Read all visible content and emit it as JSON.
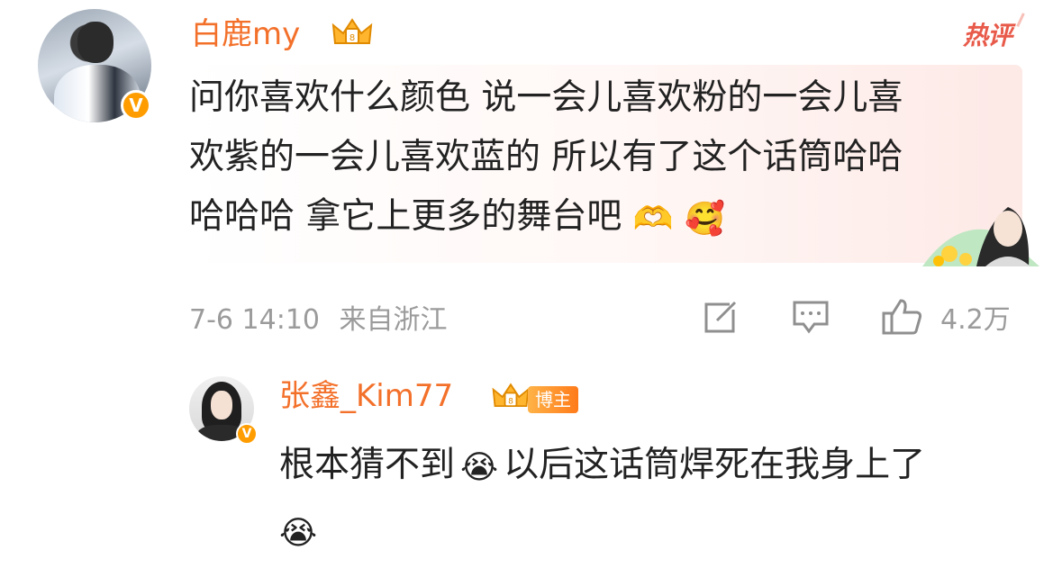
{
  "main_comment": {
    "username": "白鹿my",
    "hot_tag": "热评",
    "text_lines": [
      "问你喜欢什么颜色 说一会儿喜欢粉的一会儿喜",
      "欢紫的一会儿喜欢蓝的 所以有了这个话筒哈哈",
      "哈哈哈 拿它上更多的舞台吧"
    ],
    "emojis": [
      "🫶",
      "🥰"
    ],
    "timestamp": "7-6 14:10",
    "location": "来自浙江",
    "like_count": "4.2万",
    "icons": [
      "share-icon",
      "comment-icon",
      "like-icon"
    ]
  },
  "reply": {
    "username": "张鑫_Kim77",
    "badge": "博主",
    "text_part1": "根本猜不到",
    "text_part2": "以后这话筒焊死在我身上了",
    "emoji": "😭"
  },
  "colors": {
    "username": "#f3702a",
    "verified": "#ff9d00",
    "hot": "#e85a4a",
    "meta": "#9b9b9b"
  }
}
